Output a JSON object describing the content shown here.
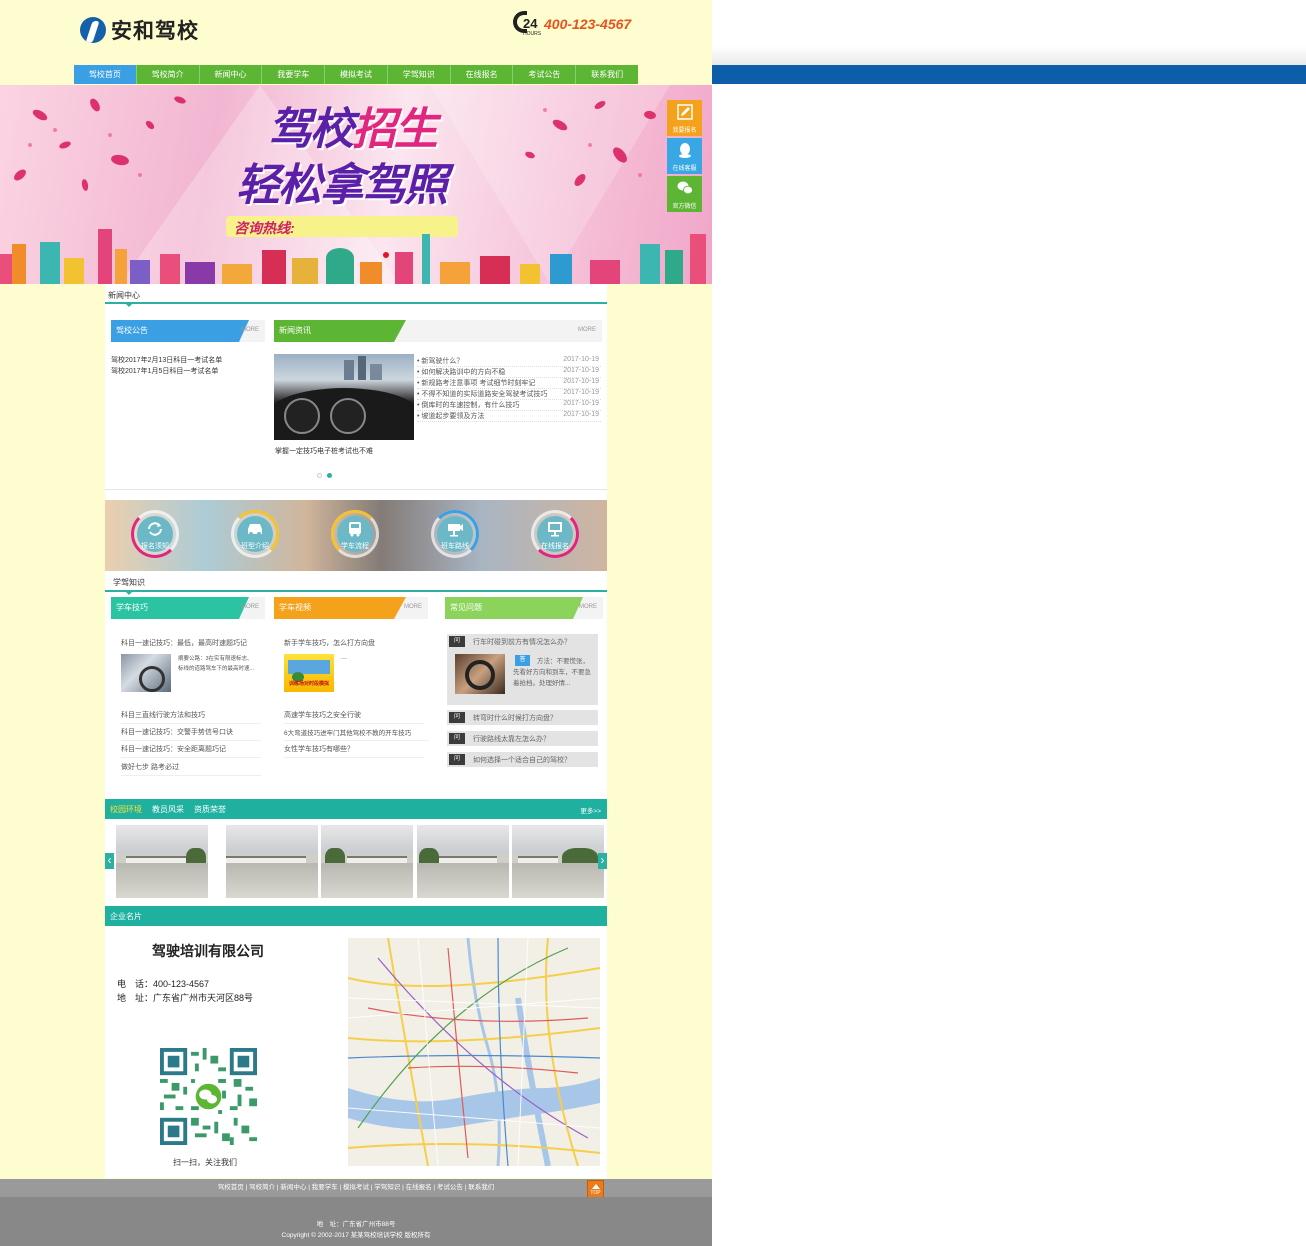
{
  "header": {
    "logo_text": "安和驾校",
    "phone_24": "24",
    "phone_hours": "HOURS",
    "phone_number": "400-123-4567"
  },
  "nav": [
    "驾校首页",
    "驾校简介",
    "新闻中心",
    "我要学车",
    "模拟考试",
    "学驾知识",
    "在线报名",
    "考试公告",
    "联系我们"
  ],
  "banner": {
    "line1a": "驾校",
    "line1b": "招生",
    "line2": "轻松拿驾照",
    "hotline": "咨询热线:"
  },
  "side": {
    "signup": "我要报名",
    "service": "在线客服",
    "wechat": "官方微信"
  },
  "news_section": {
    "title": "新闻中心",
    "notice": {
      "tab": "驾校公告",
      "more": "MORE",
      "items": [
        "驾校2017年2月13日科目一考试名单",
        "驾校2017年1月5日科目一考试名单"
      ]
    },
    "news": {
      "tab": "新闻资讯",
      "more": "MORE",
      "caption": "掌握一定技巧电子桩考试也不难",
      "items": [
        {
          "t": "• 新驾驶什么？",
          "d": "2017-10-19"
        },
        {
          "t": "• 如何解决路训中的方向不稳",
          "d": "2017-10-19"
        },
        {
          "t": "• 新规路考注意事项 考试细节时刻牢记",
          "d": "2017-10-19"
        },
        {
          "t": "• 不得不知道的实际道路安全驾驶考试技巧",
          "d": "2017-10-19"
        },
        {
          "t": "• 倒库时的车速控制，有什么技巧",
          "d": "2017-10-19"
        },
        {
          "t": "• 坡道起步要领及方法",
          "d": "2017-10-19"
        }
      ]
    }
  },
  "circles": [
    "报名须知",
    "班型介绍",
    "学车流程",
    "班车路线",
    "在线报名"
  ],
  "knowledge": {
    "title": "学驾知识",
    "tips": {
      "tab": "学车技巧",
      "more": "MORE",
      "top": "科目一速记技巧：最低，最高时速题巧记",
      "summary": "摘要公路：3在实有限速标志、标线的道路驾车下的最高时速...",
      "items": [
        "科目三直线行驶方法和技巧",
        "科目一速记技巧：交警手势信号口诀",
        "科目一速记技巧：安全距离题巧记",
        "做好七步 路考必过"
      ]
    },
    "video": {
      "tab": "学车视频",
      "more": "MORE",
      "top": "新手学车技巧，怎么打方向盘",
      "thumb_label": "训练场对时段模拟",
      "summary": "...",
      "items": [
        "高速学车技巧之安全行驶",
        "6大弯道技巧进牢门其他驾校不教的开车技巧",
        "女性学车技巧有哪些？"
      ]
    },
    "faq": {
      "tab": "常见问题",
      "more": "MORE",
      "q_label": "问",
      "a_label": "答",
      "top_q": "行车时碰到前方有情况怎么办？",
      "answer": "方法：不要慌张，先看好方向和到车，不要急着抢档。处理好情...",
      "items": [
        "转弯时什么时候打方向盘？",
        "行驶路线太靠左怎么办？",
        "如何选择一个适合自己的驾校？"
      ]
    }
  },
  "gallery": {
    "tabs": [
      "校园环境",
      "教员风采",
      "资质荣誉"
    ],
    "more": "更多>>",
    "prev": "‹",
    "next": "›"
  },
  "card": {
    "title": "企业名片",
    "company": "驾驶培训有限公司",
    "tel_label": "电　话：",
    "tel": "400-123-4567",
    "addr_label": "地　址：",
    "addr": "广东省广州市天河区88号",
    "qr_caption": "扫一扫，关注我们"
  },
  "footer": {
    "links": "驾校首页 | 驾校简介 | 新闻中心 | 我要学车 | 模拟考试 | 学驾知识 | 在线报名 | 考试公告 | 联系我们",
    "address": "地　址：广东省广州市88号",
    "copyright": "Copyright © 2002-2017 某某驾校培训学校 版权所有",
    "top": "TOP"
  },
  "colors": {
    "nav": "#5db534",
    "nav_active": "#3aa0e3",
    "teal": "#2bb1a2",
    "orange": "#f4a21b",
    "page_bg": "#fefdcf"
  }
}
